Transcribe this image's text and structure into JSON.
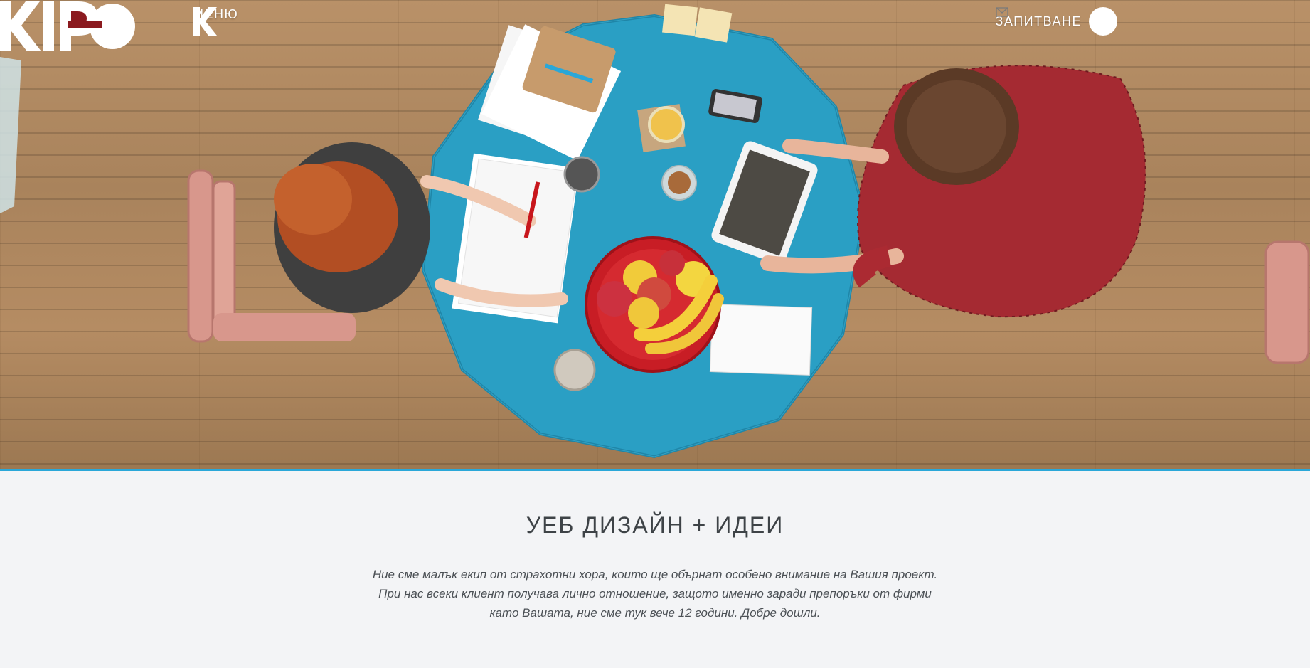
{
  "header": {
    "menu_label": "МЕНЮ",
    "inquiry_label": "ЗАПИТВАНЕ",
    "logo_icon": "k-logo-icon",
    "mail_icon": "envelope-icon"
  },
  "hero": {
    "logo_text": "KIPO",
    "accent_color": "#2aa7d8",
    "table_color": "#2a9fc4",
    "logo_accent_color": "#8b1a1f"
  },
  "intro": {
    "headline": "УЕБ ДИЗАЙН + ИДЕИ",
    "paragraph": "Ние сме малък екип от страхотни хора, които ще обърнат особено внимание на Вашия проект. При нас всеки клиент получава лично отношение, защото именно заради препоръки от фирми като Вашата, ние сме тук вече 12 години. Добре дошли."
  }
}
